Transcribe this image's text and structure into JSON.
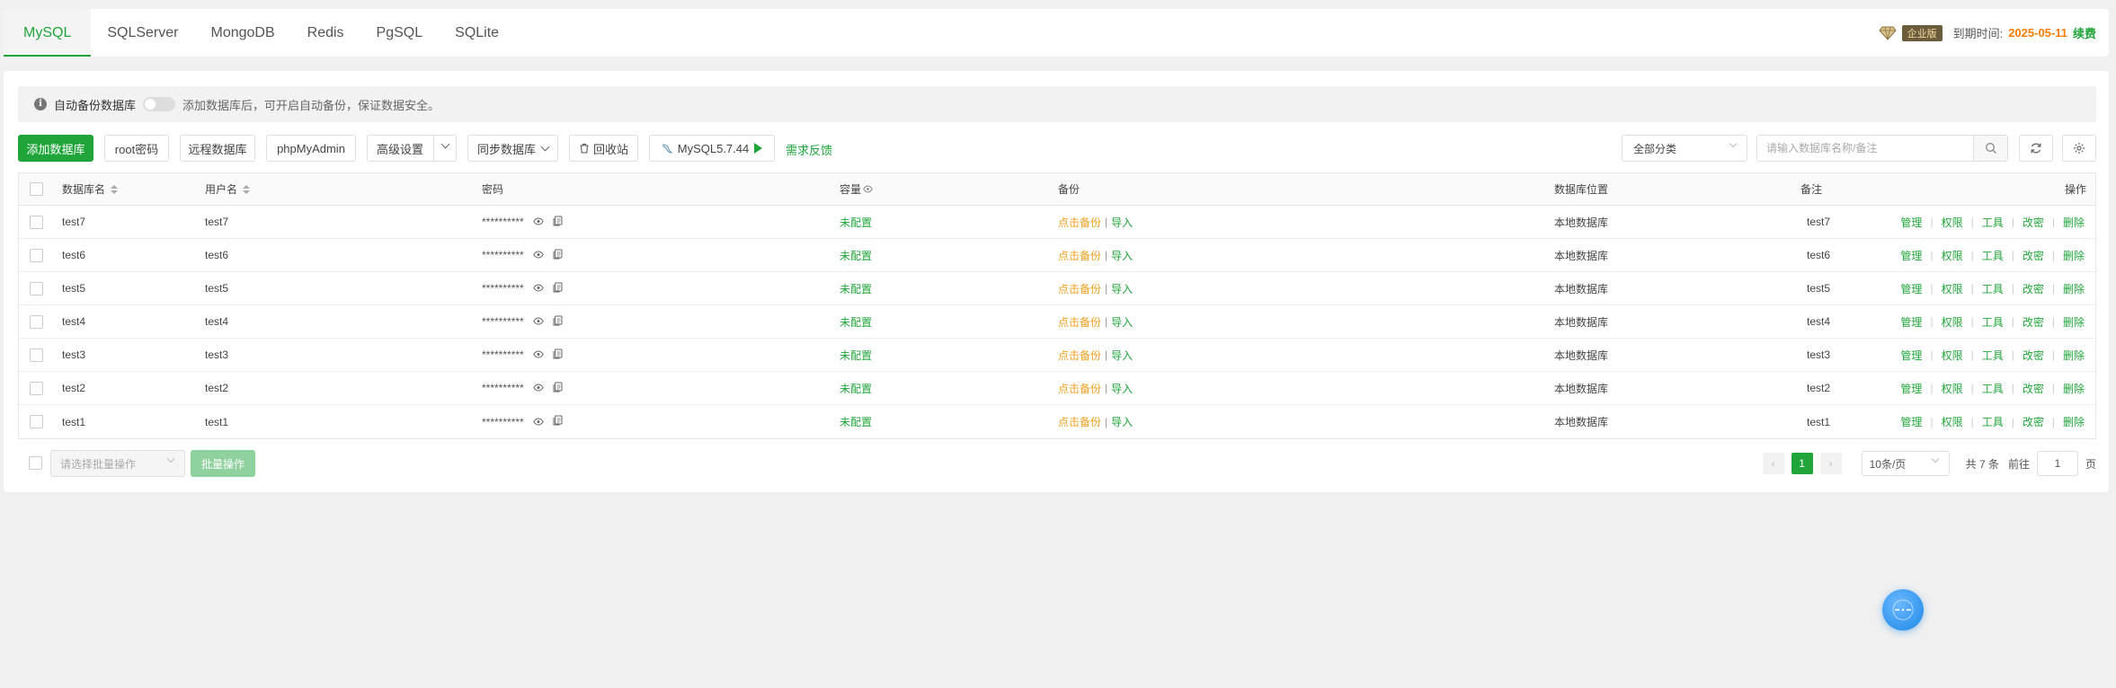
{
  "tabs": [
    "MySQL",
    "SQLServer",
    "MongoDB",
    "Redis",
    "PgSQL",
    "SQLite"
  ],
  "active_tab": "MySQL",
  "top_right": {
    "edition": "企业版",
    "expire_label": "到期时间:",
    "expire_date": "2025-05-11",
    "renew": "续费"
  },
  "tip": {
    "title": "自动备份数据库",
    "text": "添加数据库后，可开启自动备份，保证数据安全。",
    "toggle_on": false
  },
  "toolbar": {
    "add": "添加数据库",
    "root_password": "root密码",
    "remote_db": "远程数据库",
    "phpmyadmin": "phpMyAdmin",
    "advanced": "高级设置",
    "sync": "同步数据库",
    "recycle": "回收站",
    "version": "MySQL5.7.44",
    "feedback": "需求反馈",
    "category": "全部分类",
    "search_placeholder": "请输入数据库名称/备注"
  },
  "columns": {
    "name": "数据库名",
    "user": "用户名",
    "password": "密码",
    "capacity": "容量",
    "backup": "备份",
    "location": "数据库位置",
    "remark": "备注",
    "ops": "操作"
  },
  "rows": [
    {
      "name": "test7",
      "user": "test7",
      "password": "**********",
      "capacity": "未配置",
      "backup": "点击备份",
      "import": "导入",
      "location": "本地数据库",
      "remark": "test7"
    },
    {
      "name": "test6",
      "user": "test6",
      "password": "**********",
      "capacity": "未配置",
      "backup": "点击备份",
      "import": "导入",
      "location": "本地数据库",
      "remark": "test6"
    },
    {
      "name": "test5",
      "user": "test5",
      "password": "**********",
      "capacity": "未配置",
      "backup": "点击备份",
      "import": "导入",
      "location": "本地数据库",
      "remark": "test5"
    },
    {
      "name": "test4",
      "user": "test4",
      "password": "**********",
      "capacity": "未配置",
      "backup": "点击备份",
      "import": "导入",
      "location": "本地数据库",
      "remark": "test4"
    },
    {
      "name": "test3",
      "user": "test3",
      "password": "**********",
      "capacity": "未配置",
      "backup": "点击备份",
      "import": "导入",
      "location": "本地数据库",
      "remark": "test3"
    },
    {
      "name": "test2",
      "user": "test2",
      "password": "**********",
      "capacity": "未配置",
      "backup": "点击备份",
      "import": "导入",
      "location": "本地数据库",
      "remark": "test2"
    },
    {
      "name": "test1",
      "user": "test1",
      "password": "**********",
      "capacity": "未配置",
      "backup": "点击备份",
      "import": "导入",
      "location": "本地数据库",
      "remark": "test1"
    }
  ],
  "row_ops": [
    "管理",
    "权限",
    "工具",
    "改密",
    "删除"
  ],
  "footer": {
    "batch_placeholder": "请选择批量操作",
    "batch_button": "批量操作",
    "current_page": "1",
    "page_size": "10条/页",
    "total": "共 7 条",
    "goto_label": "前往",
    "goto_value": "1",
    "page_suffix": "页"
  },
  "colors": {
    "accent": "#20a53a",
    "orange": "#f57c00",
    "backup": "#f0a020"
  }
}
